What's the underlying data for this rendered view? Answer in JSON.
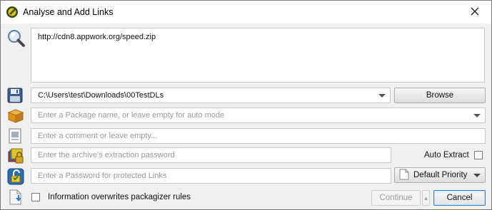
{
  "window": {
    "title": "Analyse and Add Links"
  },
  "links": {
    "value": "http://cdn8.appwork.org/speed.zip"
  },
  "download_path": {
    "value": "C:\\Users\\test\\Downloads\\00TestDLs"
  },
  "browse_button": {
    "label": "Browse"
  },
  "package_name": {
    "placeholder": "Enter a Package name, or leave empty for auto mode"
  },
  "comment": {
    "placeholder": "Enter a comment or leave empty..."
  },
  "extraction_password": {
    "placeholder": "Enter the archive's extraction password"
  },
  "auto_extract": {
    "label": "Auto Extract",
    "checked": false
  },
  "link_password": {
    "placeholder": "Enter a Password for protected Links"
  },
  "priority": {
    "label": "Default Priority"
  },
  "packagizer": {
    "label": "Information overwrites packagizer rules",
    "checked": false
  },
  "continue_button": {
    "label": "Continue",
    "enabled": false
  },
  "cancel_button": {
    "label": "Cancel"
  },
  "icons": [
    "app-icon",
    "close-icon",
    "magnifier-icon",
    "floppy-icon",
    "package-icon",
    "comment-icon",
    "archive-lock-icon",
    "unlock-icon",
    "document-arrow-icon",
    "chevron-down-icon",
    "page-icon"
  ]
}
